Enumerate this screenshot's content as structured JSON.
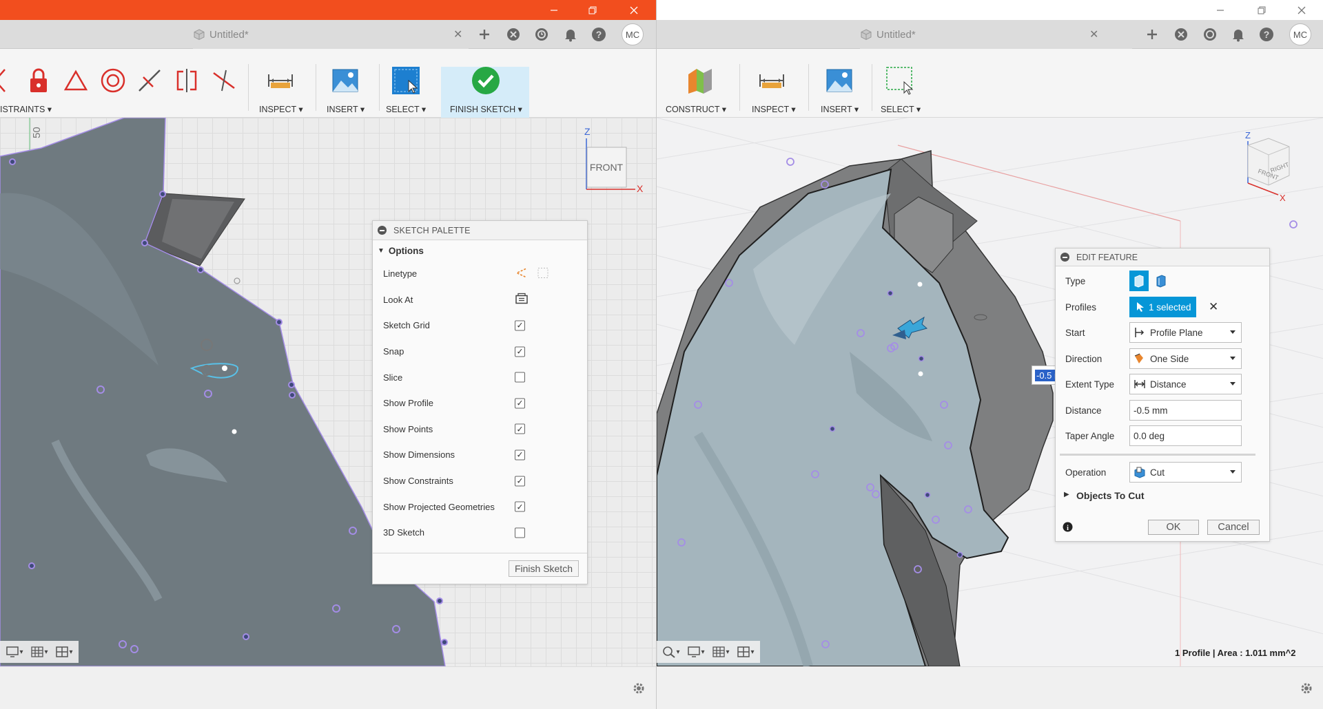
{
  "left_window": {
    "tab_title": "Untitled*",
    "avatar": "MC",
    "ribbon": {
      "constraints_label": "ISTRAINTS ▾",
      "inspect_label": "INSPECT ▾",
      "insert_label": "INSERT ▾",
      "select_label": "SELECT ▾",
      "finish_label": "FINISH SKETCH ▾"
    },
    "ruler_value": "50",
    "viewcube": {
      "face": "FRONT",
      "axis_z": "Z",
      "axis_x": "X"
    },
    "sketch_palette": {
      "title": "SKETCH PALETTE",
      "section": "Options",
      "rows": [
        {
          "label": "Linetype",
          "control": "icons"
        },
        {
          "label": "Look At",
          "control": "icon"
        },
        {
          "label": "Sketch Grid",
          "checked": true
        },
        {
          "label": "Snap",
          "checked": true
        },
        {
          "label": "Slice",
          "checked": false
        },
        {
          "label": "Show Profile",
          "checked": true
        },
        {
          "label": "Show Points",
          "checked": true
        },
        {
          "label": "Show Dimensions",
          "checked": true
        },
        {
          "label": "Show Constraints",
          "checked": true
        },
        {
          "label": "Show Projected Geometries",
          "checked": true
        },
        {
          "label": "3D Sketch",
          "checked": false
        }
      ],
      "finish_button": "Finish Sketch"
    }
  },
  "right_window": {
    "tab_title": "Untitled*",
    "avatar": "MC",
    "ribbon": {
      "construct_label": "CONSTRUCT ▾",
      "inspect_label": "INSPECT ▾",
      "insert_label": "INSERT ▾",
      "select_label": "SELECT ▾"
    },
    "viewcube": {
      "face_front": "FRONT",
      "face_right": "RIGHT",
      "axis_z": "Z",
      "axis_x": "X"
    },
    "dimension_input": "-0.5 mm",
    "edit_feature": {
      "title": "EDIT FEATURE",
      "type_label": "Type",
      "profiles_label": "Profiles",
      "profiles_value": "1 selected",
      "start_label": "Start",
      "start_value": "Profile Plane",
      "direction_label": "Direction",
      "direction_value": "One Side",
      "extent_label": "Extent Type",
      "extent_value": "Distance",
      "distance_label": "Distance",
      "distance_value": "-0.5 mm",
      "taper_label": "Taper Angle",
      "taper_value": "0.0 deg",
      "operation_label": "Operation",
      "operation_value": "Cut",
      "objects_label": "Objects To Cut",
      "ok": "OK",
      "cancel": "Cancel"
    },
    "status": "1 Profile | Area : 1.011 mm^2"
  },
  "colors": {
    "accent_orange": "#f24e1e",
    "select_blue": "#0696d7",
    "check_green": "#27a844",
    "constraint_red": "#d9302b",
    "sketch_fill": "#6f7a80",
    "body_fill": "#9fb0b8",
    "wall_fill": "#7e7f80"
  }
}
